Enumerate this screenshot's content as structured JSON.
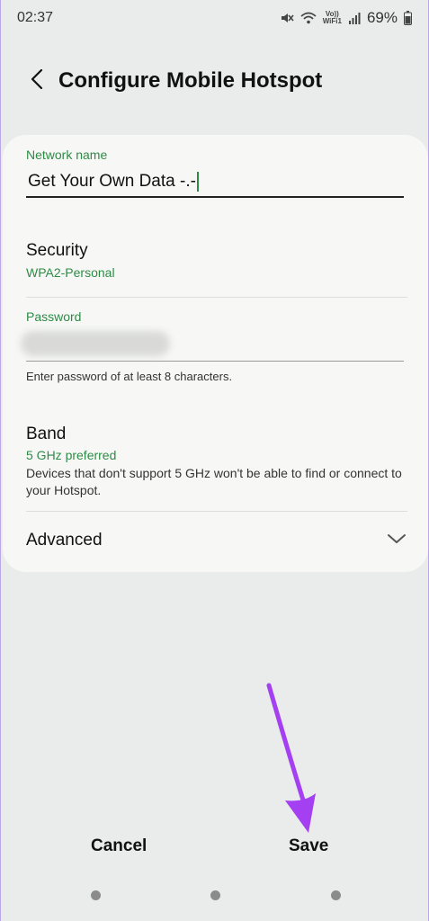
{
  "status_bar": {
    "time": "02:37",
    "battery": "69%",
    "volte_top": "Vo))",
    "volte_bottom": "WiFi1",
    "icons": [
      "mute-icon",
      "wifi-icon",
      "volte-icon",
      "signal-icon",
      "battery-icon"
    ]
  },
  "header": {
    "back_icon": "chevron-left-icon",
    "title": "Configure Mobile Hotspot"
  },
  "form": {
    "network_name": {
      "label": "Network name",
      "value": "Get Your Own Data -.-"
    },
    "security": {
      "title": "Security",
      "value": "WPA2-Personal"
    },
    "password": {
      "label": "Password",
      "hint": "Enter password of at least 8 characters."
    },
    "band": {
      "title": "Band",
      "value": "5 GHz preferred",
      "description": "Devices that don't support 5 GHz won't be able to find or connect to your Hotspot."
    },
    "advanced": {
      "title": "Advanced",
      "icon": "chevron-down-icon"
    }
  },
  "actions": {
    "cancel": "Cancel",
    "save": "Save"
  },
  "colors": {
    "accent_green": "#2e8b46",
    "background": "#e9ecea",
    "card": "#f7f8f6",
    "annotation_arrow": "#a43ff2"
  }
}
